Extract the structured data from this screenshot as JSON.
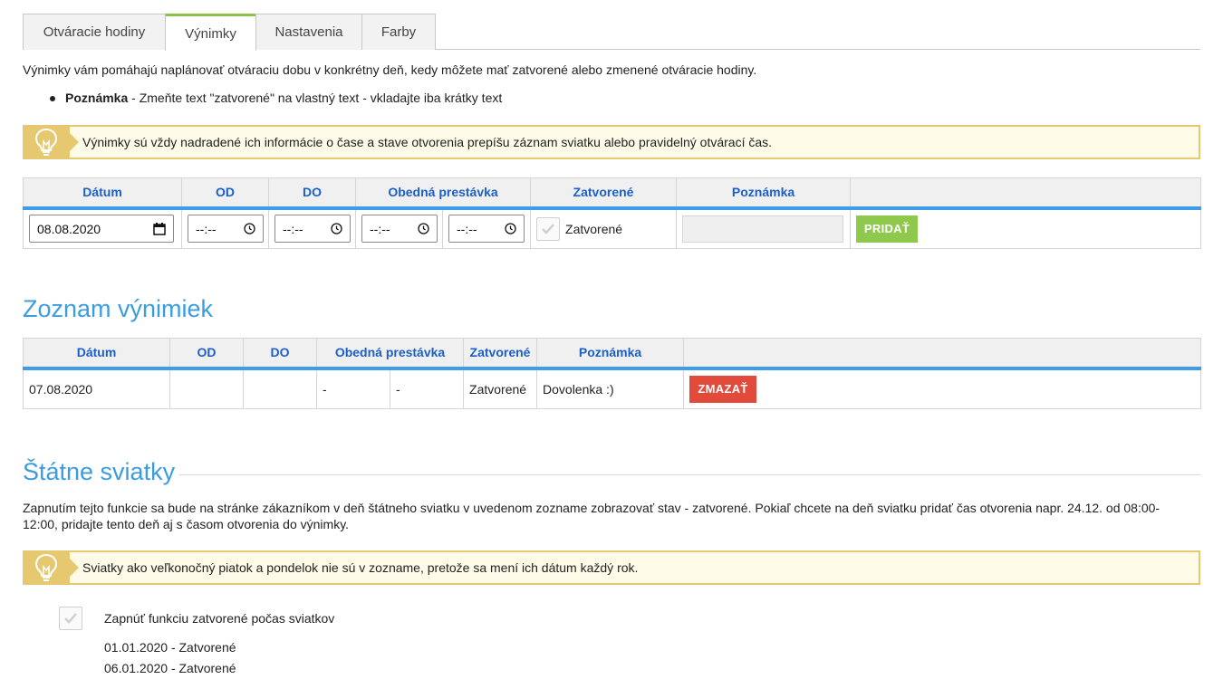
{
  "tabs": [
    {
      "label": "Otváracie hodiny"
    },
    {
      "label": "Výnimky"
    },
    {
      "label": "Nastavenia"
    },
    {
      "label": "Farby"
    }
  ],
  "intro": "Výnimky vám pomáhajú naplánovať otváraciu dobu v konkrétny deň, kedy môžete mať zatvorené alebo zmenené otváracie hodiny.",
  "note_bold": "Poznámka",
  "note_rest": " - Zmeňte text \"zatvorené\" na vlastný text - vkladajte iba krátky text",
  "tip1": "Výnimky sú vždy nadradené ich informácie o čase a stave otvorenia prepíšu záznam sviatku alebo pravidelný otvárací čas.",
  "form_table": {
    "headers": {
      "date": "Dátum",
      "from": "OD",
      "to": "DO",
      "lunch": "Obedná prestávka",
      "closed": "Zatvorené",
      "note": "Poznámka"
    },
    "date_value": "08.08.2020",
    "time_placeholder": "--:--",
    "closed_label": "Zatvorené",
    "add_button": "PRIDAŤ"
  },
  "list_title": "Zoznam výnimiek",
  "list_table": {
    "headers": {
      "date": "Dátum",
      "from": "OD",
      "to": "DO",
      "lunch": "Obedná prestávka",
      "closed": "Zatvorené",
      "note": "Poznámka"
    },
    "rows": [
      {
        "date": "07.08.2020",
        "from": "",
        "to": "",
        "lunch_from": "-",
        "lunch_to": "-",
        "closed": "Zatvorené",
        "note": "Dovolenka :)",
        "delete": "ZMAZAŤ"
      }
    ]
  },
  "holidays_title": "Štátne sviatky",
  "holidays_paragraph": "Zapnutím tejto funkcie sa bude na stránke zákazníkom v deň štátneho sviatku v uvedenom zozname zobrazovať stav - zatvorené. Pokiaľ chcete na deň sviatku pridať čas otvorenia napr. 24.12. od 08:00-12:00, pridajte tento deň aj s časom otvorenia do výnimky.",
  "tip2": "Sviatky ako veľkonočný piatok a pondelok nie sú v zozname, pretože sa mení ich dátum každý rok.",
  "enable_label": "Zapnúť funkciu zatvorené počas sviatkov",
  "holiday_items": [
    "01.01.2020 - Zatvorené",
    "06.01.2020 - Zatvorené"
  ],
  "colors": {
    "accent_blue": "#3a9de0",
    "header_text": "#1c5fc8",
    "add_green": "#8ec94d",
    "delete_red": "#e24a3b",
    "tip_border": "#e6c870"
  },
  "icons": {
    "tip": "lightbulb-icon",
    "date_picker": "calendar-icon",
    "time_picker": "clock-icon",
    "checkbox": "checkmark-icon"
  }
}
